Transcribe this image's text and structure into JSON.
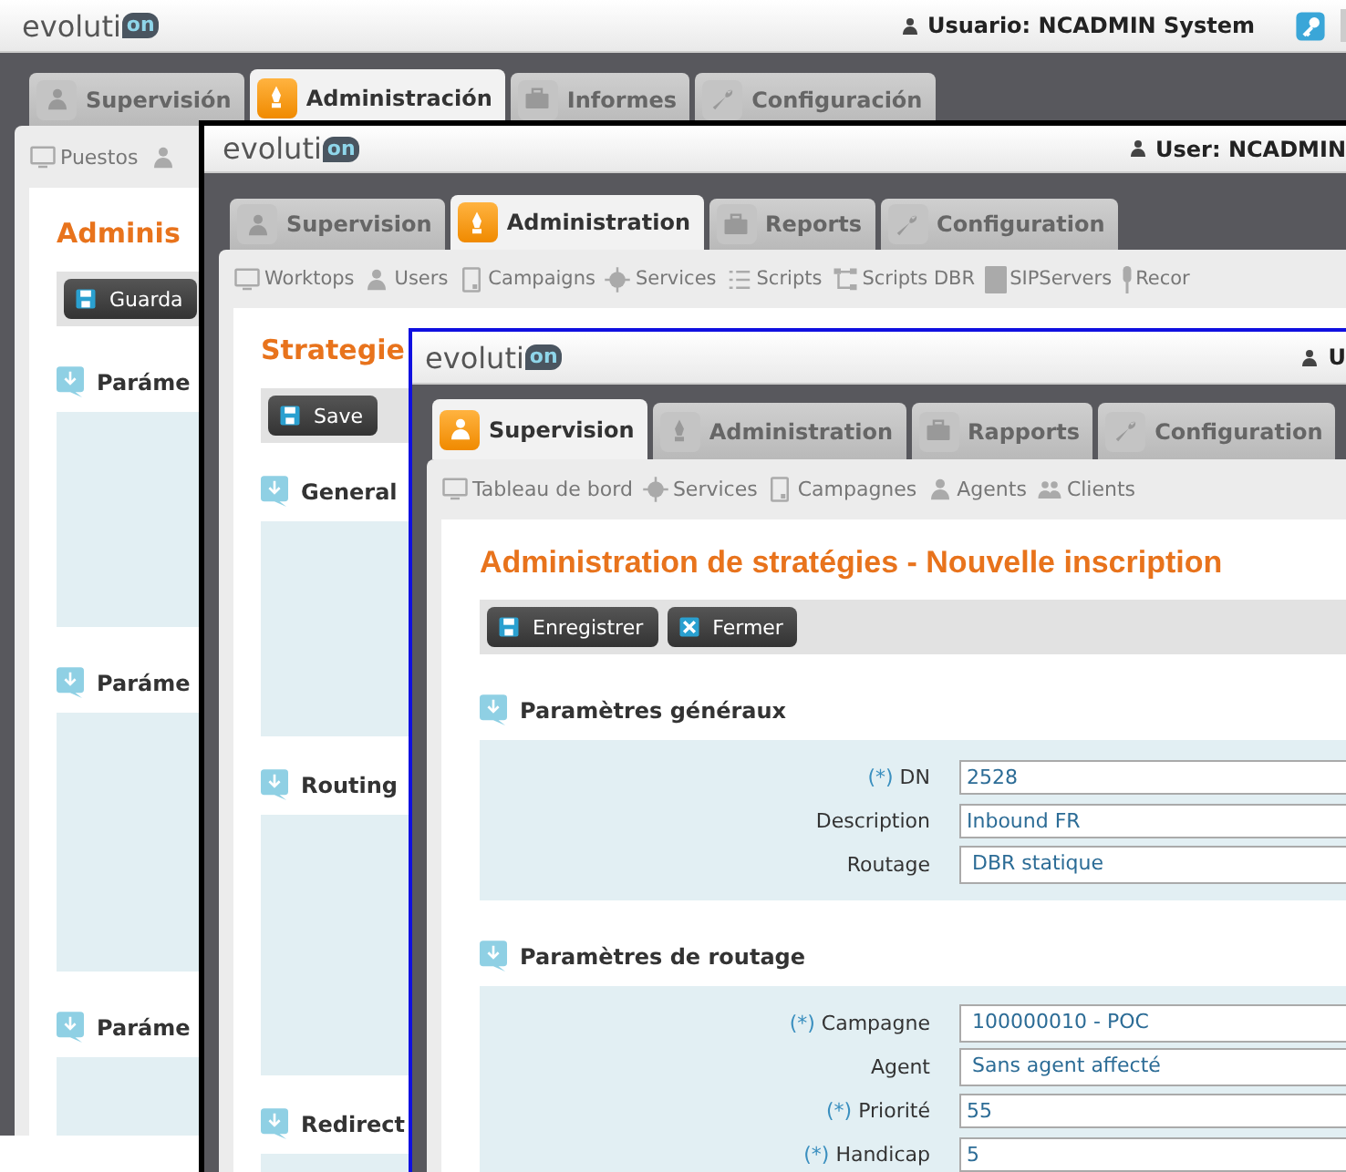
{
  "windows": [
    {
      "logo": {
        "text": "evoluti",
        "mark": "on"
      },
      "user": "Usuario: NCADMIN System",
      "tabs": [
        {
          "label": "Supervisión",
          "selected": false
        },
        {
          "label": "Administración",
          "selected": true
        },
        {
          "label": "Informes",
          "selected": false
        },
        {
          "label": "Configuración",
          "selected": false
        }
      ],
      "subnav": [
        {
          "label": "Puestos"
        }
      ],
      "title": "Adminis",
      "buttons": [
        {
          "label": "Guarda"
        }
      ],
      "sections": [
        {
          "title": "Paráme"
        },
        {
          "title": "Paráme"
        },
        {
          "title": "Paráme"
        }
      ]
    },
    {
      "logo": {
        "text": "evoluti",
        "mark": "on"
      },
      "user": "User: NCADMIN",
      "tabs": [
        {
          "label": "Supervision",
          "selected": false
        },
        {
          "label": "Administration",
          "selected": true
        },
        {
          "label": "Reports",
          "selected": false
        },
        {
          "label": "Configuration",
          "selected": false
        }
      ],
      "subnav": [
        {
          "label": "Worktops"
        },
        {
          "label": "Users"
        },
        {
          "label": "Campaigns"
        },
        {
          "label": "Services"
        },
        {
          "label": "Scripts"
        },
        {
          "label": "Scripts DBR"
        },
        {
          "label": "SIPServers"
        },
        {
          "label": "Recor"
        }
      ],
      "title": "Strategie",
      "buttons": [
        {
          "label": "Save"
        }
      ],
      "sections": [
        {
          "title": "General"
        },
        {
          "title": "Routing"
        },
        {
          "title": "Redirect"
        }
      ]
    },
    {
      "logo": {
        "text": "evoluti",
        "mark": "on"
      },
      "user": "U",
      "tabs": [
        {
          "label": "Supervision",
          "selected": true
        },
        {
          "label": "Administration",
          "selected": false
        },
        {
          "label": "Rapports",
          "selected": false
        },
        {
          "label": "Configuration",
          "selected": false
        }
      ],
      "subnav": [
        {
          "label": "Tableau de bord"
        },
        {
          "label": "Services"
        },
        {
          "label": "Campagnes"
        },
        {
          "label": "Agents"
        },
        {
          "label": "Clients"
        }
      ],
      "title": "Administration de stratégies - Nouvelle inscription",
      "buttons": [
        {
          "label": "Enregistrer"
        },
        {
          "label": "Fermer"
        }
      ],
      "sections": [
        {
          "title": "Paramètres généraux",
          "fields": [
            {
              "marker": "(*)",
              "label": "DN",
              "kind": "text",
              "value": "2528"
            },
            {
              "label": "Description",
              "kind": "text",
              "value": "Inbound FR"
            },
            {
              "label": "Routage",
              "kind": "select",
              "value": "DBR statique"
            }
          ]
        },
        {
          "title": "Paramètres de routage",
          "fields": [
            {
              "marker": "(*)",
              "label": "Campagne",
              "kind": "select",
              "value": "100000010 - POC"
            },
            {
              "label": "Agent",
              "kind": "select",
              "value": "Sans agent affecté"
            },
            {
              "marker": "(*)",
              "label": "Priorité",
              "kind": "text",
              "value": "55"
            },
            {
              "marker": "(*)",
              "label": "Handicap",
              "kind": "text",
              "value": "5"
            }
          ]
        }
      ]
    }
  ]
}
